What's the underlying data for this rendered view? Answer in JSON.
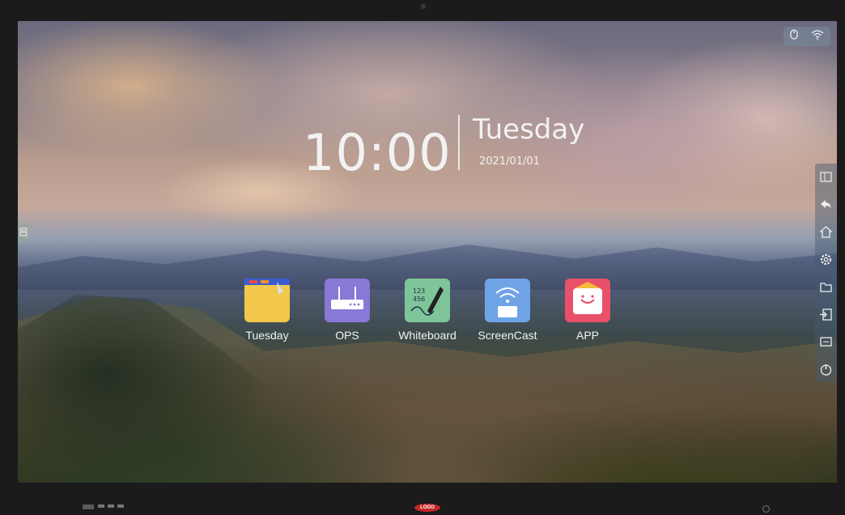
{
  "clock": {
    "time": "10:00",
    "day": "Tuesday",
    "date": "2021/01/01"
  },
  "status": {
    "icons": [
      "mouse-icon",
      "wifi-icon"
    ]
  },
  "apps": [
    {
      "label": "Tuesday",
      "icon": "notepad-icon",
      "color": "#f1c84b"
    },
    {
      "label": "OPS",
      "icon": "router-icon",
      "color": "#8a78d6"
    },
    {
      "label": "Whiteboard",
      "icon": "whiteboard-icon",
      "color": "#7fc59a"
    },
    {
      "label": "ScreenCast",
      "icon": "screencast-icon",
      "color": "#6fa3e6"
    },
    {
      "label": "APP",
      "icon": "app-store-icon",
      "color": "#e9506a"
    }
  ],
  "sidebar": {
    "items": [
      "window-icon",
      "back-icon",
      "home-icon",
      "settings-icon",
      "folder-icon",
      "input-source-icon",
      "screen-icon",
      "power-icon"
    ]
  },
  "bezel": {
    "logo_text": "LOGO"
  }
}
